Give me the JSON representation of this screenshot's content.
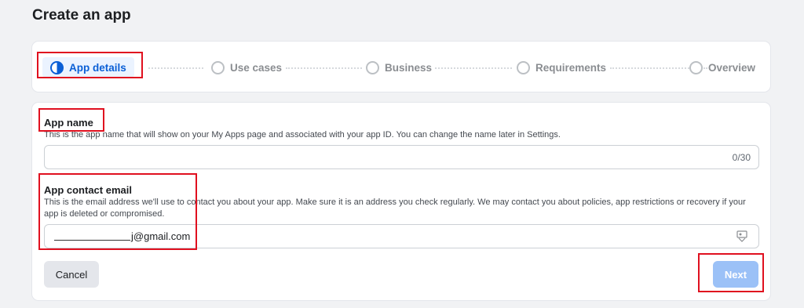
{
  "page": {
    "title": "Create an app"
  },
  "steps": [
    {
      "label": "App details",
      "state": "active"
    },
    {
      "label": "Use cases",
      "state": "pending"
    },
    {
      "label": "Business",
      "state": "pending"
    },
    {
      "label": "Requirements",
      "state": "pending"
    },
    {
      "label": "Overview",
      "state": "pending"
    }
  ],
  "form": {
    "app_name": {
      "label": "App name",
      "help": "This is the app name that will show on your My Apps page and associated with your app ID. You can change the name later in Settings.",
      "value": "",
      "counter": "0/30"
    },
    "contact_email": {
      "label": "App contact email",
      "help": "This is the email address we'll use to contact you about your app. Make sure it is an address you check regularly. We may contact you about policies, app restrictions or recovery if your app is deleted or compromised.",
      "value": "j@gmail.com"
    }
  },
  "buttons": {
    "cancel": "Cancel",
    "next": "Next"
  },
  "colors": {
    "accent": "#0a5fd6",
    "highlight": "#e0101f",
    "next_disabled": "#9bc1f7"
  }
}
